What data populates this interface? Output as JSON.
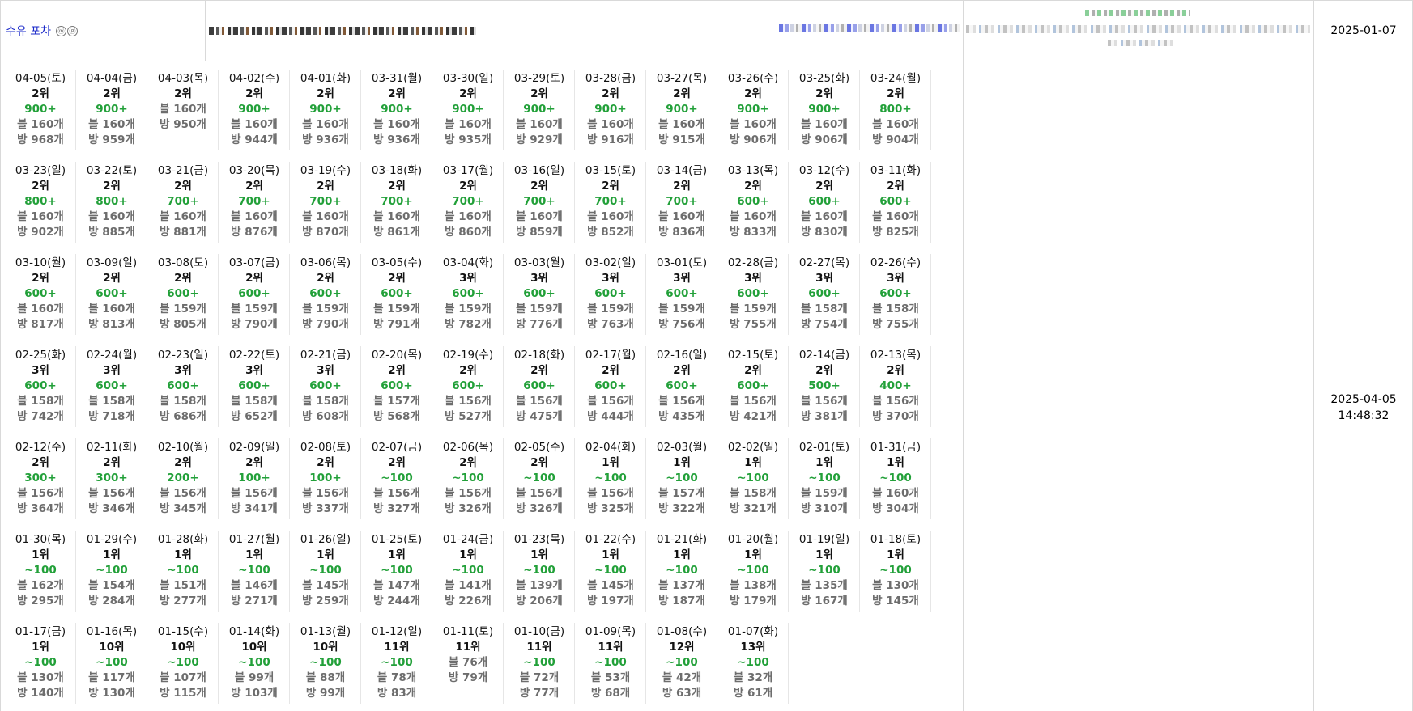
{
  "header": {
    "store_name": "수유 포차",
    "badges": [
      "ⓜ",
      "ⓟ"
    ],
    "registered_date": "2025-01-07",
    "checked_at_date": "2025-04-05",
    "checked_at_time": "14:48:32"
  },
  "days": [
    {
      "date": "04-05(토)",
      "rank": "2위",
      "visits": "900+",
      "blog": "블 160개",
      "bang": "방 968개"
    },
    {
      "date": "04-04(금)",
      "rank": "2위",
      "visits": "900+",
      "blog": "블 160개",
      "bang": "방 959개"
    },
    {
      "date": "04-03(목)",
      "rank": "2위",
      "visits": "",
      "blog": "블 160개",
      "bang": "방 950개"
    },
    {
      "date": "04-02(수)",
      "rank": "2위",
      "visits": "900+",
      "blog": "블 160개",
      "bang": "방 944개"
    },
    {
      "date": "04-01(화)",
      "rank": "2위",
      "visits": "900+",
      "blog": "블 160개",
      "bang": "방 936개"
    },
    {
      "date": "03-31(월)",
      "rank": "2위",
      "visits": "900+",
      "blog": "블 160개",
      "bang": "방 936개"
    },
    {
      "date": "03-30(일)",
      "rank": "2위",
      "visits": "900+",
      "blog": "블 160개",
      "bang": "방 935개"
    },
    {
      "date": "03-29(토)",
      "rank": "2위",
      "visits": "900+",
      "blog": "블 160개",
      "bang": "방 929개"
    },
    {
      "date": "03-28(금)",
      "rank": "2위",
      "visits": "900+",
      "blog": "블 160개",
      "bang": "방 916개"
    },
    {
      "date": "03-27(목)",
      "rank": "2위",
      "visits": "900+",
      "blog": "블 160개",
      "bang": "방 915개"
    },
    {
      "date": "03-26(수)",
      "rank": "2위",
      "visits": "900+",
      "blog": "블 160개",
      "bang": "방 906개"
    },
    {
      "date": "03-25(화)",
      "rank": "2위",
      "visits": "900+",
      "blog": "블 160개",
      "bang": "방 906개"
    },
    {
      "date": "03-24(월)",
      "rank": "2위",
      "visits": "800+",
      "blog": "블 160개",
      "bang": "방 904개"
    },
    {
      "date": "03-23(일)",
      "rank": "2위",
      "visits": "800+",
      "blog": "블 160개",
      "bang": "방 902개"
    },
    {
      "date": "03-22(토)",
      "rank": "2위",
      "visits": "800+",
      "blog": "블 160개",
      "bang": "방 885개"
    },
    {
      "date": "03-21(금)",
      "rank": "2위",
      "visits": "700+",
      "blog": "블 160개",
      "bang": "방 881개"
    },
    {
      "date": "03-20(목)",
      "rank": "2위",
      "visits": "700+",
      "blog": "블 160개",
      "bang": "방 876개"
    },
    {
      "date": "03-19(수)",
      "rank": "2위",
      "visits": "700+",
      "blog": "블 160개",
      "bang": "방 870개"
    },
    {
      "date": "03-18(화)",
      "rank": "2위",
      "visits": "700+",
      "blog": "블 160개",
      "bang": "방 861개"
    },
    {
      "date": "03-17(월)",
      "rank": "2위",
      "visits": "700+",
      "blog": "블 160개",
      "bang": "방 860개"
    },
    {
      "date": "03-16(일)",
      "rank": "2위",
      "visits": "700+",
      "blog": "블 160개",
      "bang": "방 859개"
    },
    {
      "date": "03-15(토)",
      "rank": "2위",
      "visits": "700+",
      "blog": "블 160개",
      "bang": "방 852개"
    },
    {
      "date": "03-14(금)",
      "rank": "2위",
      "visits": "700+",
      "blog": "블 160개",
      "bang": "방 836개"
    },
    {
      "date": "03-13(목)",
      "rank": "2위",
      "visits": "600+",
      "blog": "블 160개",
      "bang": "방 833개"
    },
    {
      "date": "03-12(수)",
      "rank": "2위",
      "visits": "600+",
      "blog": "블 160개",
      "bang": "방 830개"
    },
    {
      "date": "03-11(화)",
      "rank": "2위",
      "visits": "600+",
      "blog": "블 160개",
      "bang": "방 825개"
    },
    {
      "date": "03-10(월)",
      "rank": "2위",
      "visits": "600+",
      "blog": "블 160개",
      "bang": "방 817개"
    },
    {
      "date": "03-09(일)",
      "rank": "2위",
      "visits": "600+",
      "blog": "블 160개",
      "bang": "방 813개"
    },
    {
      "date": "03-08(토)",
      "rank": "2위",
      "visits": "600+",
      "blog": "블 159개",
      "bang": "방 805개"
    },
    {
      "date": "03-07(금)",
      "rank": "2위",
      "visits": "600+",
      "blog": "블 159개",
      "bang": "방 790개"
    },
    {
      "date": "03-06(목)",
      "rank": "2위",
      "visits": "600+",
      "blog": "블 159개",
      "bang": "방 790개"
    },
    {
      "date": "03-05(수)",
      "rank": "2위",
      "visits": "600+",
      "blog": "블 159개",
      "bang": "방 791개"
    },
    {
      "date": "03-04(화)",
      "rank": "3위",
      "visits": "600+",
      "blog": "블 159개",
      "bang": "방 782개"
    },
    {
      "date": "03-03(월)",
      "rank": "3위",
      "visits": "600+",
      "blog": "블 159개",
      "bang": "방 776개"
    },
    {
      "date": "03-02(일)",
      "rank": "3위",
      "visits": "600+",
      "blog": "블 159개",
      "bang": "방 763개"
    },
    {
      "date": "03-01(토)",
      "rank": "3위",
      "visits": "600+",
      "blog": "블 159개",
      "bang": "방 756개"
    },
    {
      "date": "02-28(금)",
      "rank": "3위",
      "visits": "600+",
      "blog": "블 159개",
      "bang": "방 755개"
    },
    {
      "date": "02-27(목)",
      "rank": "3위",
      "visits": "600+",
      "blog": "블 158개",
      "bang": "방 754개"
    },
    {
      "date": "02-26(수)",
      "rank": "3위",
      "visits": "600+",
      "blog": "블 158개",
      "bang": "방 755개"
    },
    {
      "date": "02-25(화)",
      "rank": "3위",
      "visits": "600+",
      "blog": "블 158개",
      "bang": "방 742개"
    },
    {
      "date": "02-24(월)",
      "rank": "3위",
      "visits": "600+",
      "blog": "블 158개",
      "bang": "방 718개"
    },
    {
      "date": "02-23(일)",
      "rank": "3위",
      "visits": "600+",
      "blog": "블 158개",
      "bang": "방 686개"
    },
    {
      "date": "02-22(토)",
      "rank": "3위",
      "visits": "600+",
      "blog": "블 158개",
      "bang": "방 652개"
    },
    {
      "date": "02-21(금)",
      "rank": "3위",
      "visits": "600+",
      "blog": "블 158개",
      "bang": "방 608개"
    },
    {
      "date": "02-20(목)",
      "rank": "2위",
      "visits": "600+",
      "blog": "블 157개",
      "bang": "방 568개"
    },
    {
      "date": "02-19(수)",
      "rank": "2위",
      "visits": "600+",
      "blog": "블 156개",
      "bang": "방 527개"
    },
    {
      "date": "02-18(화)",
      "rank": "2위",
      "visits": "600+",
      "blog": "블 156개",
      "bang": "방 475개"
    },
    {
      "date": "02-17(월)",
      "rank": "2위",
      "visits": "600+",
      "blog": "블 156개",
      "bang": "방 444개"
    },
    {
      "date": "02-16(일)",
      "rank": "2위",
      "visits": "600+",
      "blog": "블 156개",
      "bang": "방 435개"
    },
    {
      "date": "02-15(토)",
      "rank": "2위",
      "visits": "600+",
      "blog": "블 156개",
      "bang": "방 421개"
    },
    {
      "date": "02-14(금)",
      "rank": "2위",
      "visits": "500+",
      "blog": "블 156개",
      "bang": "방 381개"
    },
    {
      "date": "02-13(목)",
      "rank": "2위",
      "visits": "400+",
      "blog": "블 156개",
      "bang": "방 370개"
    },
    {
      "date": "02-12(수)",
      "rank": "2위",
      "visits": "300+",
      "blog": "블 156개",
      "bang": "방 364개"
    },
    {
      "date": "02-11(화)",
      "rank": "2위",
      "visits": "300+",
      "blog": "블 156개",
      "bang": "방 346개"
    },
    {
      "date": "02-10(월)",
      "rank": "2위",
      "visits": "200+",
      "blog": "블 156개",
      "bang": "방 345개"
    },
    {
      "date": "02-09(일)",
      "rank": "2위",
      "visits": "100+",
      "blog": "블 156개",
      "bang": "방 341개"
    },
    {
      "date": "02-08(토)",
      "rank": "2위",
      "visits": "100+",
      "blog": "블 156개",
      "bang": "방 337개"
    },
    {
      "date": "02-07(금)",
      "rank": "2위",
      "visits": "~100",
      "blog": "블 156개",
      "bang": "방 327개"
    },
    {
      "date": "02-06(목)",
      "rank": "2위",
      "visits": "~100",
      "blog": "블 156개",
      "bang": "방 326개"
    },
    {
      "date": "02-05(수)",
      "rank": "2위",
      "visits": "~100",
      "blog": "블 156개",
      "bang": "방 326개"
    },
    {
      "date": "02-04(화)",
      "rank": "1위",
      "visits": "~100",
      "blog": "블 156개",
      "bang": "방 325개"
    },
    {
      "date": "02-03(월)",
      "rank": "1위",
      "visits": "~100",
      "blog": "블 157개",
      "bang": "방 322개"
    },
    {
      "date": "02-02(일)",
      "rank": "1위",
      "visits": "~100",
      "blog": "블 158개",
      "bang": "방 321개"
    },
    {
      "date": "02-01(토)",
      "rank": "1위",
      "visits": "~100",
      "blog": "블 159개",
      "bang": "방 310개"
    },
    {
      "date": "01-31(금)",
      "rank": "1위",
      "visits": "~100",
      "blog": "블 160개",
      "bang": "방 304개"
    },
    {
      "date": "01-30(목)",
      "rank": "1위",
      "visits": "~100",
      "blog": "블 162개",
      "bang": "방 295개"
    },
    {
      "date": "01-29(수)",
      "rank": "1위",
      "visits": "~100",
      "blog": "블 154개",
      "bang": "방 284개"
    },
    {
      "date": "01-28(화)",
      "rank": "1위",
      "visits": "~100",
      "blog": "블 151개",
      "bang": "방 277개"
    },
    {
      "date": "01-27(월)",
      "rank": "1위",
      "visits": "~100",
      "blog": "블 146개",
      "bang": "방 271개"
    },
    {
      "date": "01-26(일)",
      "rank": "1위",
      "visits": "~100",
      "blog": "블 145개",
      "bang": "방 259개"
    },
    {
      "date": "01-25(토)",
      "rank": "1위",
      "visits": "~100",
      "blog": "블 147개",
      "bang": "방 244개"
    },
    {
      "date": "01-24(금)",
      "rank": "1위",
      "visits": "~100",
      "blog": "블 141개",
      "bang": "방 226개"
    },
    {
      "date": "01-23(목)",
      "rank": "1위",
      "visits": "~100",
      "blog": "블 139개",
      "bang": "방 206개"
    },
    {
      "date": "01-22(수)",
      "rank": "1위",
      "visits": "~100",
      "blog": "블 145개",
      "bang": "방 197개"
    },
    {
      "date": "01-21(화)",
      "rank": "1위",
      "visits": "~100",
      "blog": "블 137개",
      "bang": "방 187개"
    },
    {
      "date": "01-20(월)",
      "rank": "1위",
      "visits": "~100",
      "blog": "블 138개",
      "bang": "방 179개"
    },
    {
      "date": "01-19(일)",
      "rank": "1위",
      "visits": "~100",
      "blog": "블 135개",
      "bang": "방 167개"
    },
    {
      "date": "01-18(토)",
      "rank": "1위",
      "visits": "~100",
      "blog": "블 130개",
      "bang": "방 145개"
    },
    {
      "date": "01-17(금)",
      "rank": "1위",
      "visits": "~100",
      "blog": "블 130개",
      "bang": "방 140개"
    },
    {
      "date": "01-16(목)",
      "rank": "10위",
      "visits": "~100",
      "blog": "블 117개",
      "bang": "방 130개"
    },
    {
      "date": "01-15(수)",
      "rank": "10위",
      "visits": "~100",
      "blog": "블 107개",
      "bang": "방 115개"
    },
    {
      "date": "01-14(화)",
      "rank": "10위",
      "visits": "~100",
      "blog": "블 99개",
      "bang": "방 103개"
    },
    {
      "date": "01-13(월)",
      "rank": "10위",
      "visits": "~100",
      "blog": "블 88개",
      "bang": "방 99개"
    },
    {
      "date": "01-12(일)",
      "rank": "11위",
      "visits": "~100",
      "blog": "블 78개",
      "bang": "방 83개"
    },
    {
      "date": "01-11(토)",
      "rank": "11위",
      "visits": "",
      "blog": "블 76개",
      "bang": "방 79개"
    },
    {
      "date": "01-10(금)",
      "rank": "11위",
      "visits": "~100",
      "blog": "블 72개",
      "bang": "방 77개"
    },
    {
      "date": "01-09(목)",
      "rank": "11위",
      "visits": "~100",
      "blog": "블 53개",
      "bang": "방 68개"
    },
    {
      "date": "01-08(수)",
      "rank": "12위",
      "visits": "~100",
      "blog": "블 42개",
      "bang": "방 63개"
    },
    {
      "date": "01-07(화)",
      "rank": "13위",
      "visits": "~100",
      "blog": "블 32개",
      "bang": "방 61개"
    }
  ]
}
